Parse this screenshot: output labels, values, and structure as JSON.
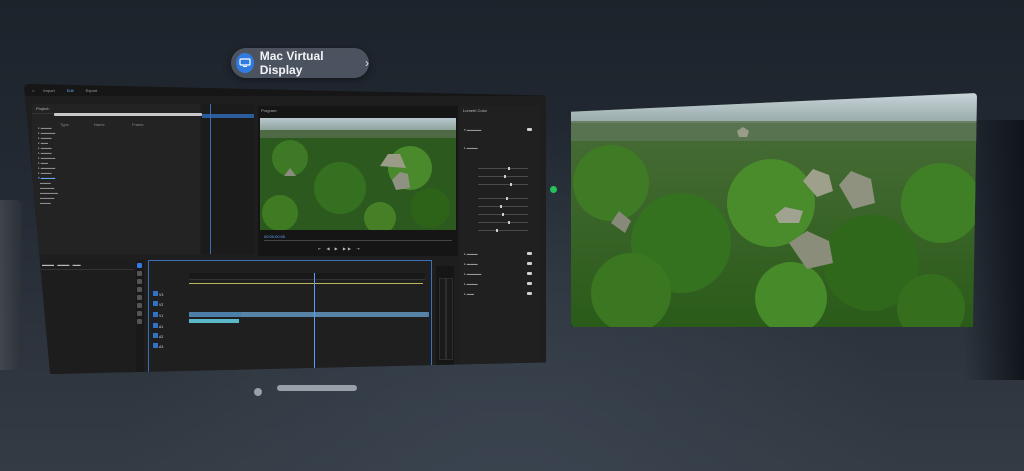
{
  "header": {
    "pill_label": "Mac Virtual Display",
    "pill_icon": "display-screen-icon",
    "pill_chevron": "chevron-right-icon"
  },
  "mac_window": {
    "topbar_tabs": [
      "Import",
      "Edit",
      "Export"
    ],
    "active_tab": "Edit",
    "project_panel": {
      "title": "Project: ",
      "columns": [
        "Type",
        "Name",
        "Frame"
      ]
    },
    "program_monitor": {
      "title": "Program: ",
      "timecode": "00:00:00:00"
    },
    "effect_controls": {
      "title": "Lumetri Color"
    },
    "timeline": {
      "title": ""
    }
  },
  "colors": {
    "accent": "#2f7be0",
    "selection": "#3b6fb8",
    "status_dot": "#27c15a"
  }
}
